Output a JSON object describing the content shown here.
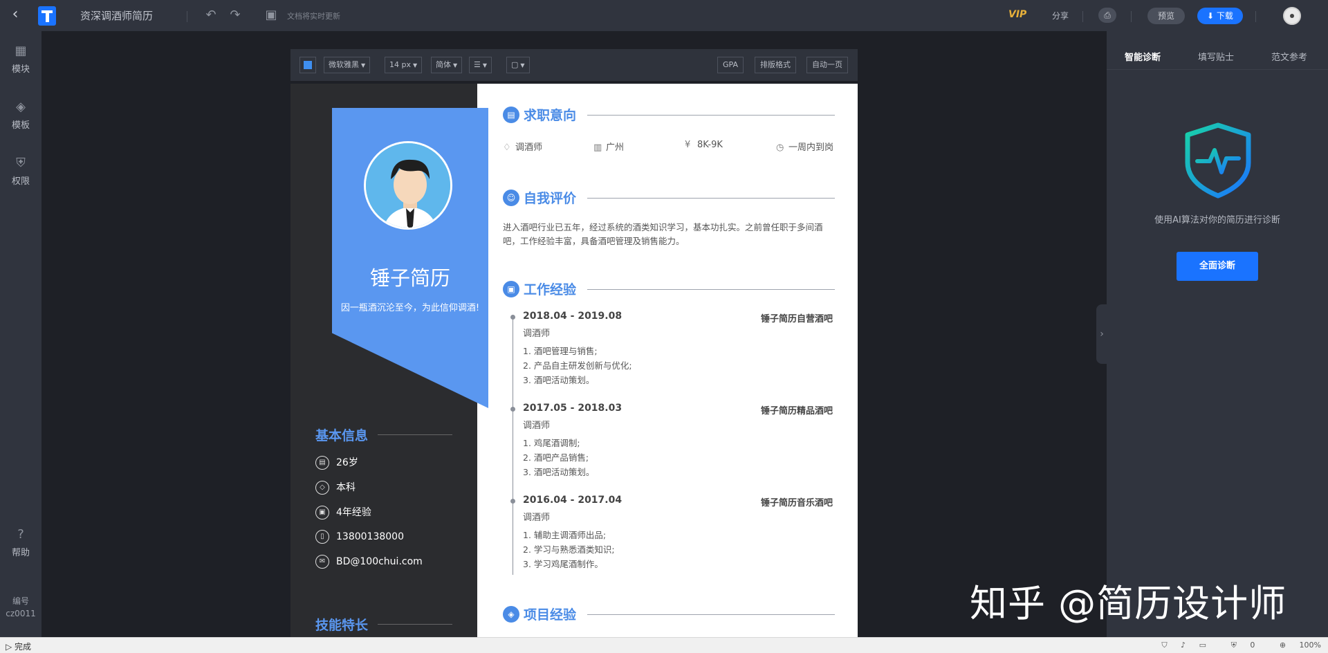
{
  "topbar": {
    "title": "资深调酒师简历",
    "save_status": "文档将实时更新",
    "vip_label": "VIP",
    "share_label": "分享",
    "print_icon": "print-icon",
    "preview_label": "预览",
    "download_label": "下载"
  },
  "sidebar": {
    "items": [
      {
        "label": "模块",
        "icon": "blocks-icon"
      },
      {
        "label": "模板",
        "icon": "layers-icon"
      },
      {
        "label": "权限",
        "icon": "shield-icon"
      }
    ],
    "help_label": "帮助",
    "code_label": "编号",
    "code_value": "cz0011"
  },
  "toolbar": {
    "font": "微软雅黑",
    "size": "14 px",
    "script": "简体",
    "gpa": "GPA",
    "layout": "排版格式",
    "auto_page": "自动一页"
  },
  "resume": {
    "name": "锤子简历",
    "motto": "因一瓶酒沉沦至今，为此信仰调酒!",
    "basic_info_title": "基本信息",
    "basic_info": [
      {
        "icon": "calendar-icon",
        "value": "26岁"
      },
      {
        "icon": "graduation-icon",
        "value": "本科"
      },
      {
        "icon": "briefcase-icon",
        "value": "4年经验"
      },
      {
        "icon": "phone-icon",
        "value": "13800138000"
      },
      {
        "icon": "email-icon",
        "value": "BD@100chui.com"
      }
    ],
    "skills_title": "技能特长",
    "intent_title": "求职意向",
    "intent": [
      {
        "icon": "tie-icon",
        "value": "调酒师"
      },
      {
        "icon": "building-icon",
        "value": "广州"
      },
      {
        "icon": "yen-icon",
        "value": "8K-9K"
      },
      {
        "icon": "clock-icon",
        "value": "一周内到岗"
      }
    ],
    "self_title": "自我评价",
    "self_text": "进入酒吧行业已五年，经过系统的酒类知识学习，基本功扎实。之前曾任职于多间酒吧，工作经验丰富，具备酒吧管理及销售能力。",
    "work_title": "工作经验",
    "jobs": [
      {
        "date": "2018.04 - 2019.08",
        "company": "锤子简历自营酒吧",
        "title": "调酒师",
        "desc": [
          "1. 酒吧管理与销售;",
          "2. 产品自主研发创新与优化;",
          "3. 酒吧活动策划。"
        ]
      },
      {
        "date": "2017.05 - 2018.03",
        "company": "锤子简历精品酒吧",
        "title": "调酒师",
        "desc": [
          "1. 鸡尾酒调制;",
          "2. 酒吧产品销售;",
          "3. 酒吧活动策划。"
        ]
      },
      {
        "date": "2016.04 - 2017.04",
        "company": "锤子简历音乐酒吧",
        "title": "调酒师",
        "desc": [
          "1. 辅助主调酒师出品;",
          "2. 学习与熟悉酒类知识;",
          "3. 学习鸡尾酒制作。"
        ]
      }
    ],
    "project_title": "项目经验"
  },
  "rightpanel": {
    "tabs": [
      "智能诊断",
      "填写贴士",
      "范文参考"
    ],
    "desc": "使用AI算法对你的简历进行诊断",
    "button": "全面诊断"
  },
  "watermark": "知乎 @简历设计师",
  "status": {
    "left": "完成",
    "right": [
      "0",
      "100%"
    ]
  },
  "colors": {
    "accent": "#1a73ff",
    "resume_blue": "#5a97f0",
    "dark_panel": "#30343e"
  }
}
